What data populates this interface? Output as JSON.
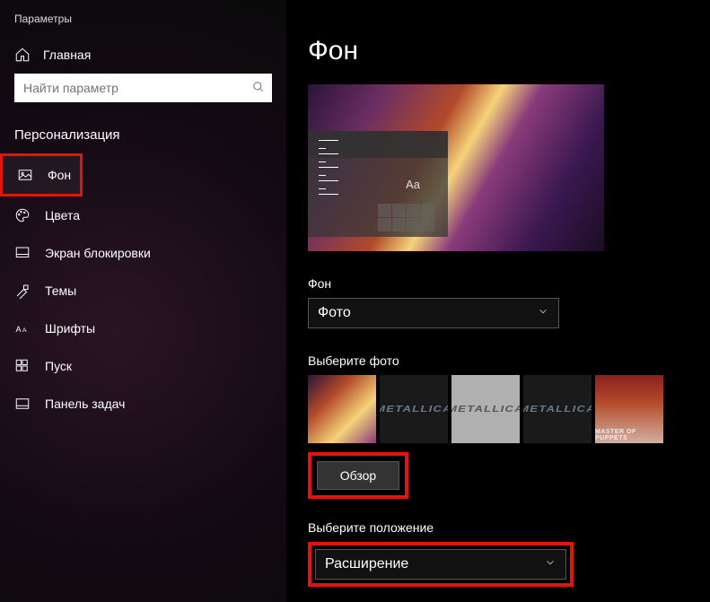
{
  "window_title": "Параметры",
  "home_label": "Главная",
  "search_placeholder": "Найти параметр",
  "section_header": "Персонализация",
  "nav": [
    {
      "label": "Фон"
    },
    {
      "label": "Цвета"
    },
    {
      "label": "Экран блокировки"
    },
    {
      "label": "Темы"
    },
    {
      "label": "Шрифты"
    },
    {
      "label": "Пуск"
    },
    {
      "label": "Панель задач"
    }
  ],
  "page_title": "Фон",
  "preview_aa": "Aa",
  "bg_label": "Фон",
  "bg_dropdown_value": "Фото",
  "choose_photo_label": "Выберите фото",
  "browse_label": "Обзор",
  "position_label": "Выберите положение",
  "position_value": "Расширение",
  "thumbs": {
    "master_caption": "MASTER OF PUPPETS",
    "logo_text": "METALLICA"
  }
}
